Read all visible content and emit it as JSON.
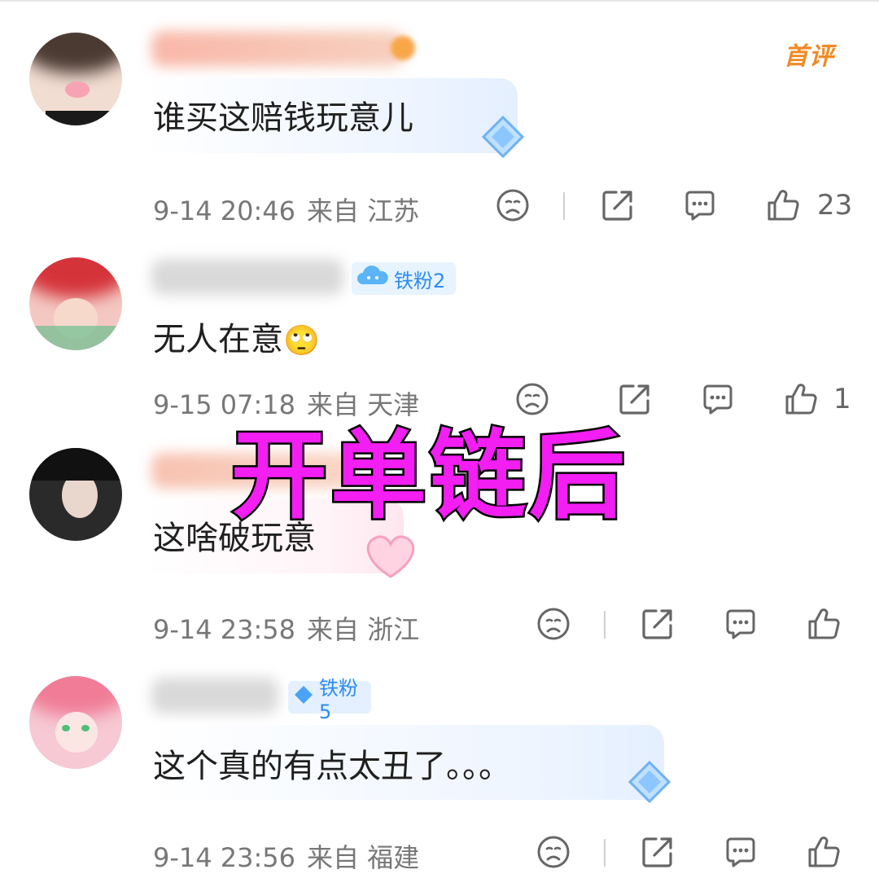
{
  "overlay_title": "开单链后",
  "first_comment_badge": "首评",
  "comments": [
    {
      "text": "谁买这赔钱玩意儿",
      "date": "9-14 20:46",
      "from": "来自 江苏",
      "likes": "23",
      "fan_badge": ""
    },
    {
      "text": "无人在意",
      "emoji": "🙄",
      "date": "9-15 07:18",
      "from": "来自 天津",
      "likes": "1",
      "fan_badge": "铁粉2"
    },
    {
      "text": "这啥破玩意",
      "date": "9-14 23:58",
      "from": "来自 浙江",
      "likes": "",
      "fan_badge": ""
    },
    {
      "text": "这个真的有点太丑了。。。",
      "date": "9-14 23:56",
      "from": "来自 福建",
      "likes": "",
      "fan_badge": "铁粉5"
    }
  ],
  "colors": {
    "overlay_fill": "#f21ef2",
    "first_badge": "#f08a24",
    "fan_badge": "#2d8cf0"
  },
  "icons": [
    "dislike-face-icon",
    "share-icon",
    "comment-icon",
    "thumbs-up-icon"
  ]
}
